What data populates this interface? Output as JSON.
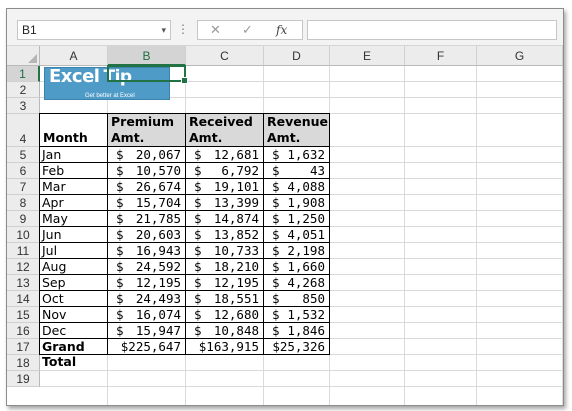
{
  "formula_bar": {
    "name_box": "B1",
    "name_box_dropdown": "▾",
    "separator": "⋮",
    "cancel_glyph": "✕",
    "enter_glyph": "✓",
    "fx_glyph": "fx",
    "formula_value": ""
  },
  "columns": [
    "A",
    "B",
    "C",
    "D",
    "E",
    "F",
    "G"
  ],
  "rows": [
    "1",
    "2",
    "3",
    "4",
    "5",
    "6",
    "7",
    "8",
    "9",
    "10",
    "11",
    "12",
    "13",
    "14",
    "15",
    "16",
    "17",
    "18",
    "19"
  ],
  "selected_cell": "B1",
  "logo": {
    "brand": "Excel",
    "brand_suffix": "Tip",
    "tagline": "Get better at Excel"
  },
  "table": {
    "headers": {
      "month": "Month",
      "premium_line1": "Premium",
      "premium_line2": "Amt.",
      "received_line1": "Received",
      "received_line2": "Amt.",
      "revenue_line1": "Revenue",
      "revenue_line2": "Amt."
    },
    "currency_symbol": "$",
    "rows": [
      {
        "month": "Jan",
        "premium": "20,067",
        "received": "12,681",
        "revenue": "1,632"
      },
      {
        "month": "Feb",
        "premium": "10,570",
        "received": "6,792",
        "revenue": "43"
      },
      {
        "month": "Mar",
        "premium": "26,674",
        "received": "19,101",
        "revenue": "4,088"
      },
      {
        "month": "Apr",
        "premium": "15,704",
        "received": "13,399",
        "revenue": "1,908"
      },
      {
        "month": "May",
        "premium": "21,785",
        "received": "14,874",
        "revenue": "1,250"
      },
      {
        "month": "Jun",
        "premium": "20,603",
        "received": "13,852",
        "revenue": "4,051"
      },
      {
        "month": "Jul",
        "premium": "16,943",
        "received": "10,733",
        "revenue": "2,198"
      },
      {
        "month": "Aug",
        "premium": "24,592",
        "received": "18,210",
        "revenue": "1,660"
      },
      {
        "month": "Sep",
        "premium": "12,195",
        "received": "12,195",
        "revenue": "4,268"
      },
      {
        "month": "Oct",
        "premium": "24,493",
        "received": "18,551",
        "revenue": "850"
      },
      {
        "month": "Nov",
        "premium": "16,074",
        "received": "12,680",
        "revenue": "1,532"
      },
      {
        "month": "Dec",
        "premium": "15,947",
        "received": "10,848",
        "revenue": "1,846"
      }
    ],
    "total": {
      "label": "Grand Total",
      "premium": "$225,647",
      "received": "$163,915",
      "revenue": "$25,326"
    }
  }
}
